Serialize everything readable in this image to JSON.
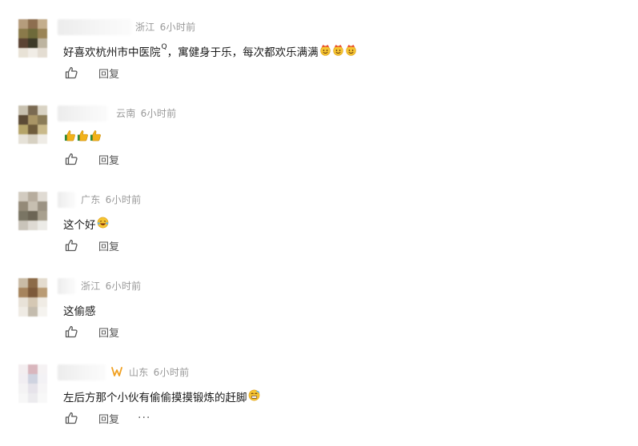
{
  "comments": [
    {
      "location": "浙江",
      "time": "6小时前",
      "text": "好喜欢杭州市中医院",
      "search_mark": "Q",
      "text_after": "，寓健身于乐，每次都欢乐满满",
      "emoji": "smile-face-with-hat-emoji",
      "emoji_count": 3,
      "reply_label": "回复",
      "avatar_colors": [
        "#b59c7c",
        "#8d6e4f",
        "#c4ae8d",
        "#8a7a4a",
        "#6e6a3a",
        "#9a8456",
        "#5b4433",
        "#3d3a28",
        "#bdb4a0",
        "#e8e2d6",
        "#f1ede6",
        "#e4ddd2"
      ]
    },
    {
      "location": "云南",
      "time": "6小时前",
      "text": "",
      "emoji": "thumbs-up-emoji",
      "emoji_count": 3,
      "reply_label": "回复",
      "avatar_colors": [
        "#c8c1b0",
        "#7a6a52",
        "#d9d3c4",
        "#5c4b36",
        "#a99566",
        "#8b7c58",
        "#b5a469",
        "#6f5c3c",
        "#c9b98a",
        "#e6e2d8",
        "#d7d1c2",
        "#efece6"
      ]
    },
    {
      "location": "广东",
      "time": "6小时前",
      "text": "这个好",
      "emoji": "laughing-tears-emoji",
      "emoji_count": 1,
      "reply_label": "回复",
      "avatar_colors": [
        "#d2cbc0",
        "#b7ad9e",
        "#e0dbd3",
        "#948a78",
        "#c7bfb1",
        "#9c9384",
        "#7a7564",
        "#6c6555",
        "#a8a08f",
        "#c9c4ba",
        "#dedad3",
        "#ecebe7"
      ]
    },
    {
      "location": "浙江",
      "time": "6小时前",
      "text": "这偷感",
      "emoji": "",
      "emoji_count": 0,
      "reply_label": "回复",
      "avatar_colors": [
        "#c9bba5",
        "#8c6b48",
        "#e4dccf",
        "#a6845d",
        "#7d5a3a",
        "#b99b74",
        "#e8e2d8",
        "#d5c8b4",
        "#f0ece5",
        "#efebe4",
        "#c4bcae",
        "#f5f3ef"
      ]
    },
    {
      "location": "山东",
      "time": "6小时前",
      "text": "左后方那个小伙有偷偷摸摸锻炼的赶脚",
      "emoji": "grimace-face-emoji",
      "emoji_count": 1,
      "reply_label": "回复",
      "more_label": "···",
      "badge_color": "#f0a020",
      "avatar_colors": [
        "#f3eef0",
        "#d9b6bd",
        "#f5f2f3",
        "#f1eef2",
        "#cfd3e0",
        "#f3f2f5",
        "#f4f3f4",
        "#e6e3ea",
        "#f6f5f6",
        "#f7f7f7",
        "#ecebee",
        "#f8f8f8"
      ]
    }
  ]
}
